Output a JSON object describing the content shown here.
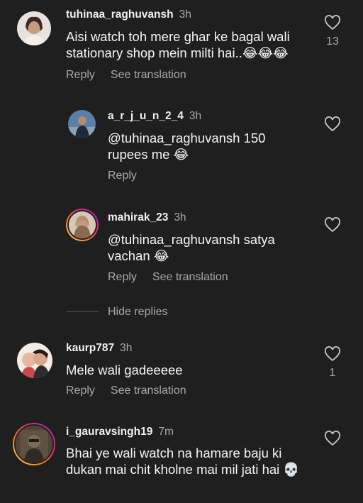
{
  "comments": [
    {
      "username": "tuhinaa_raghuvansh",
      "time": "3h",
      "text": "Aisi watch toh mere ghar ke bagal wali stationary shop mein milti hai..😂😂😂",
      "reply": "Reply",
      "translate": "See translation",
      "likes": "13"
    },
    {
      "username": "a_r_j_u_n_2_4",
      "time": "3h",
      "text": "@tuhinaa_raghuvansh 150 rupees me 😂",
      "reply": "Reply"
    },
    {
      "username": "mahirak_23",
      "time": "3h",
      "text": "@tuhinaa_raghuvansh satya vachan 😂",
      "reply": "Reply",
      "translate": "See translation"
    },
    {
      "username": "kaurp787",
      "time": "3h",
      "text": "Mele wali gadeeeee",
      "reply": "Reply",
      "translate": "See translation",
      "likes": "1"
    },
    {
      "username": "i_gauravsingh19",
      "time": "7m",
      "text": "Bhai ye wali watch na hamare baju ki dukan mai chit kholne mai mil jati hai 💀"
    }
  ],
  "hide_replies": "Hide replies",
  "colors": {
    "background": "#1f1f1f",
    "secondary": "#a8a8a8",
    "story_ring": "#d62976"
  }
}
